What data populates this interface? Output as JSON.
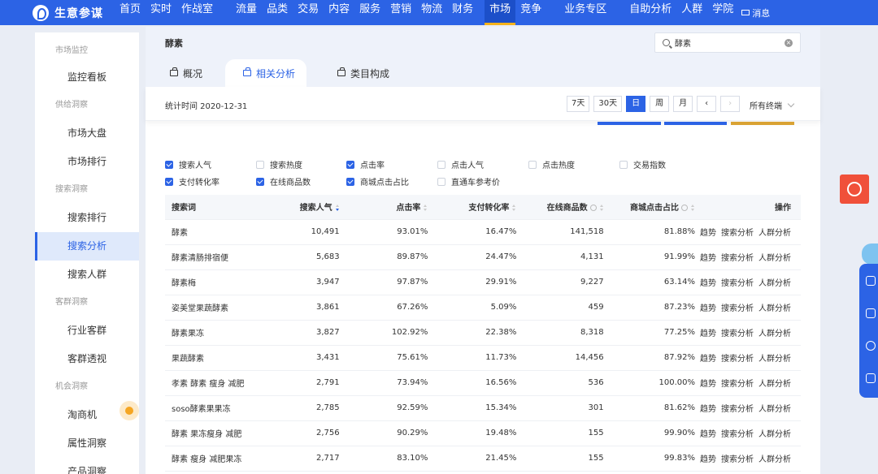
{
  "topnav": {
    "logo_text": "生意参谋",
    "items": [
      "首页",
      "实时",
      "作战室",
      "流量",
      "品类",
      "交易",
      "内容",
      "服务",
      "营销",
      "物流",
      "财务",
      "市场",
      "竞争",
      "业务专区",
      "自助分析",
      "人群",
      "学院"
    ],
    "active": "市场",
    "message": "消息"
  },
  "sidebar": {
    "groups": [
      {
        "title": "市场监控",
        "items": [
          "监控看板"
        ]
      },
      {
        "title": "供给洞察",
        "items": [
          "市场大盘",
          "市场排行"
        ]
      },
      {
        "title": "搜索洞察",
        "items": [
          "搜索排行",
          "搜索分析",
          "搜索人群"
        ]
      },
      {
        "title": "客群洞察",
        "items": [
          "行业客群",
          "客群透视"
        ]
      },
      {
        "title": "机会洞察",
        "items": [
          "淘商机",
          "属性洞察",
          "产品洞察"
        ]
      }
    ],
    "active": "搜索分析"
  },
  "header": {
    "title": "酵素",
    "search_value": "酵素",
    "tabs": [
      "概况",
      "相关分析",
      "类目构成"
    ],
    "active_tab": "相关分析"
  },
  "toolbar": {
    "stat_time": "统计时间 2020-12-31",
    "periods": [
      "7天",
      "30天",
      "日",
      "周",
      "月"
    ],
    "active_period": "日",
    "prev": "‹",
    "next": "›",
    "terminal": "所有终端"
  },
  "metrics": [
    {
      "label": "搜索人气",
      "checked": true
    },
    {
      "label": "搜索热度",
      "checked": false
    },
    {
      "label": "点击率",
      "checked": true
    },
    {
      "label": "点击人气",
      "checked": false
    },
    {
      "label": "点击热度",
      "checked": false
    },
    {
      "label": "交易指数",
      "checked": false
    },
    {
      "label": "支付转化率",
      "checked": true
    },
    {
      "label": "在线商品数",
      "checked": true
    },
    {
      "label": "商城点击占比",
      "checked": true
    },
    {
      "label": "直通车参考价",
      "checked": false
    }
  ],
  "table": {
    "headers": [
      "搜索词",
      "搜索人气",
      "点击率",
      "支付转化率",
      "在线商品数",
      "商城点击占比",
      "操作"
    ],
    "actions": [
      "趋势",
      "搜索分析",
      "人群分析"
    ],
    "rows": [
      [
        "酵素",
        "10,491",
        "93.01%",
        "16.47%",
        "141,518",
        "81.88%"
      ],
      [
        "酵素清肠排宿便",
        "5,683",
        "89.87%",
        "24.47%",
        "4,131",
        "91.99%"
      ],
      [
        "酵素梅",
        "3,947",
        "97.87%",
        "29.91%",
        "9,227",
        "63.14%"
      ],
      [
        "姿美堂果蔬酵素",
        "3,861",
        "67.26%",
        "5.09%",
        "459",
        "87.23%"
      ],
      [
        "酵素果冻",
        "3,827",
        "102.92%",
        "22.38%",
        "8,318",
        "77.25%"
      ],
      [
        "果蔬酵素",
        "3,431",
        "75.61%",
        "11.73%",
        "14,456",
        "87.92%"
      ],
      [
        "孝素 酵素 瘦身 减肥",
        "2,791",
        "73.94%",
        "16.56%",
        "536",
        "100.00%"
      ],
      [
        "soso酵素果果冻",
        "2,785",
        "92.59%",
        "15.34%",
        "301",
        "81.62%"
      ],
      [
        "酵素 果冻瘦身 减肥",
        "2,756",
        "90.29%",
        "19.48%",
        "155",
        "99.90%"
      ],
      [
        "酵素 瘦身 减肥果冻",
        "2,717",
        "83.10%",
        "21.45%",
        "155",
        "99.83%"
      ]
    ]
  },
  "colors": {
    "primary": "#2c63e5",
    "accent": "#f5b21b",
    "brand_red": "#f0503a"
  }
}
